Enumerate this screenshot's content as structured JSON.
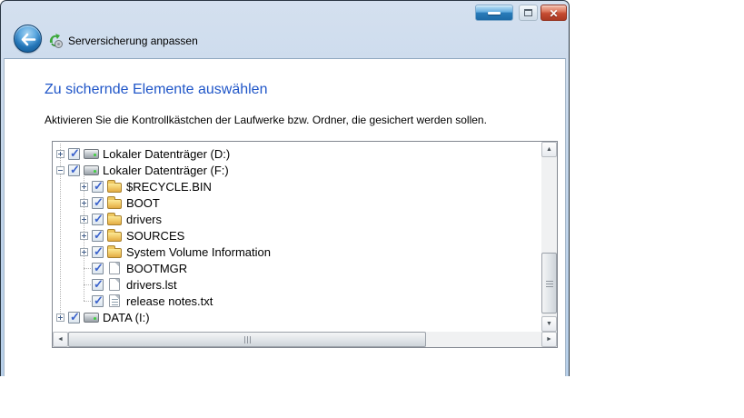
{
  "header": {
    "title": "Serversicherung anpassen"
  },
  "page": {
    "heading": "Zu sichernde Elemente auswählen",
    "instruction": "Aktivieren Sie die Kontrollkästchen der Laufwerke bzw. Ordner, die gesichert werden sollen."
  },
  "tree": {
    "items": [
      {
        "label": "Lokaler Datenträger (D:)",
        "level": 0,
        "expand": "plus",
        "icon": "drive-icon",
        "checked": true
      },
      {
        "label": "Lokaler Datenträger (F:)",
        "level": 0,
        "expand": "minus",
        "icon": "drive-icon",
        "checked": true
      },
      {
        "label": "$RECYCLE.BIN",
        "level": 1,
        "expand": "plus",
        "icon": "folder-icon",
        "checked": true
      },
      {
        "label": "BOOT",
        "level": 1,
        "expand": "plus",
        "icon": "folder-icon",
        "checked": true
      },
      {
        "label": "drivers",
        "level": 1,
        "expand": "plus",
        "icon": "folder-icon",
        "checked": true
      },
      {
        "label": "SOURCES",
        "level": 1,
        "expand": "plus",
        "icon": "folder-icon",
        "checked": true
      },
      {
        "label": "System Volume Information",
        "level": 1,
        "expand": "plus",
        "icon": "folder-icon",
        "checked": true
      },
      {
        "label": "BOOTMGR",
        "level": 1,
        "expand": "none",
        "icon": "file-icon",
        "checked": true
      },
      {
        "label": "drivers.lst",
        "level": 1,
        "expand": "none",
        "icon": "file-icon",
        "checked": true
      },
      {
        "label": "release notes.txt",
        "level": 1,
        "expand": "none",
        "icon": "file-text-icon",
        "checked": true
      },
      {
        "label": "DATA (I:)",
        "level": 0,
        "expand": "plus",
        "icon": "drive-icon",
        "checked": true
      }
    ]
  },
  "scrollbars": {
    "vertical": {
      "up_arrow": "▲",
      "down_arrow": "▼"
    },
    "horizontal": {
      "left_arrow": "◄",
      "right_arrow": "►"
    }
  },
  "colors": {
    "heading_blue": "#2056c8",
    "titlebar_top": "#d4e0ef",
    "titlebar_bottom": "#b7cfe9",
    "checkmark_blue": "#3b63cc",
    "minimize_button_blue": "#2a7cba",
    "close_button_red": "#c54b31",
    "folder_yellow": "#f3cf6e"
  }
}
